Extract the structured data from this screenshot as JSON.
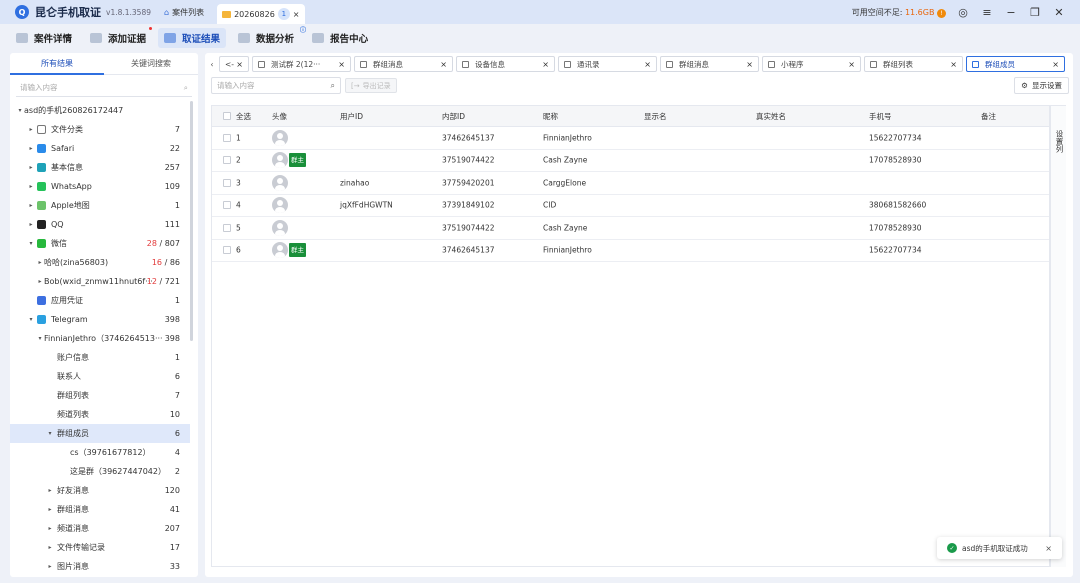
{
  "titlebar": {
    "app_name": "昆仑手机取证",
    "version": "v1.8.1.3589",
    "tabs": [
      {
        "label": "案件列表",
        "icon": "home-icon"
      },
      {
        "label": "20260826",
        "icon": "folder-icon",
        "badge": "1",
        "close": "×"
      }
    ],
    "storage_label": "可用空间不足:",
    "storage_value": "11.6GB",
    "storage_dot": "!"
  },
  "toolbar": {
    "items": [
      {
        "label": "案件详情"
      },
      {
        "label": "添加证据"
      },
      {
        "label": "取证结果"
      },
      {
        "label": "数据分析"
      },
      {
        "label": "报告中心"
      }
    ]
  },
  "left": {
    "tabs": [
      "所有结果",
      "关键词搜索"
    ],
    "search_placeholder": "请输入内容",
    "tree": [
      {
        "label": "asd的手机260826172447",
        "count": "",
        "arrow": "▾",
        "indent": 0,
        "icon": ""
      },
      {
        "label": "文件分类",
        "count": "7",
        "arrow": "▸",
        "indent": 1,
        "icon": "file-icon",
        "color": "#ffffff"
      },
      {
        "label": "Safari",
        "count": "22",
        "arrow": "▸",
        "indent": 1,
        "icon": "safari-icon",
        "color": "#2a8bea"
      },
      {
        "label": "基本信息",
        "count": "257",
        "arrow": "▸",
        "indent": 1,
        "icon": "info-icon",
        "color": "#1fa2b8"
      },
      {
        "label": "WhatsApp",
        "count": "109",
        "arrow": "▸",
        "indent": 1,
        "icon": "whatsapp-icon",
        "color": "#25c25a"
      },
      {
        "label": "Apple地图",
        "count": "1",
        "arrow": "▸",
        "indent": 1,
        "icon": "maps-icon",
        "color": "#6cc36a"
      },
      {
        "label": "QQ",
        "count": "111",
        "arrow": "▸",
        "indent": 1,
        "icon": "qq-icon",
        "color": "#222222"
      },
      {
        "label": "微信",
        "count_red": "28",
        "count_total": "807",
        "arrow": "▾",
        "indent": 1,
        "icon": "wechat-icon",
        "color": "#27b83d"
      },
      {
        "label": "哈哈(zina56803)",
        "count_red": "16",
        "count_total": "86",
        "arrow": "▸",
        "indent": 2,
        "icon": ""
      },
      {
        "label": "Bob(wxid_znmw11hnut6f···",
        "count_red": "12",
        "count_total": "721",
        "arrow": "▸",
        "indent": 2,
        "icon": ""
      },
      {
        "label": "应用凭证",
        "count": "1",
        "arrow": "",
        "indent": 1,
        "icon": "credential-icon",
        "color": "#3d6fe0"
      },
      {
        "label": "Telegram",
        "count": "398",
        "arrow": "▾",
        "indent": 1,
        "icon": "telegram-icon",
        "color": "#2aa0e0"
      },
      {
        "label": "FinnianJethro（3746264513···",
        "count": "398",
        "arrow": "▾",
        "indent": 2,
        "icon": ""
      },
      {
        "label": "账户信息",
        "count": "1",
        "arrow": "",
        "indent": 3,
        "icon": ""
      },
      {
        "label": "联系人",
        "count": "6",
        "arrow": "",
        "indent": 3,
        "icon": ""
      },
      {
        "label": "群组列表",
        "count": "7",
        "arrow": "",
        "indent": 3,
        "icon": ""
      },
      {
        "label": "频道列表",
        "count": "10",
        "arrow": "",
        "indent": 3,
        "icon": ""
      },
      {
        "label": "群组成员",
        "count": "6",
        "arrow": "▾",
        "indent": 3,
        "icon": "",
        "selected": true
      },
      {
        "label": "cs（39761677812）",
        "count": "4",
        "arrow": "",
        "indent": 4,
        "icon": ""
      },
      {
        "label": "这是群（39627447042）",
        "count": "2",
        "arrow": "",
        "indent": 4,
        "icon": ""
      },
      {
        "label": "好友消息",
        "count": "120",
        "arrow": "▸",
        "indent": 3,
        "icon": ""
      },
      {
        "label": "群组消息",
        "count": "41",
        "arrow": "▸",
        "indent": 3,
        "icon": ""
      },
      {
        "label": "频道消息",
        "count": "207",
        "arrow": "▸",
        "indent": 3,
        "icon": ""
      },
      {
        "label": "文件传输记录",
        "count": "17",
        "arrow": "▸",
        "indent": 3,
        "icon": ""
      },
      {
        "label": "图片消息",
        "count": "33",
        "arrow": "▸",
        "indent": 3,
        "icon": ""
      }
    ]
  },
  "main": {
    "tabs": [
      {
        "label": "<-",
        "close": "×",
        "w": 30
      },
      {
        "label": "测试群 2(12···",
        "close": "×",
        "w": 99
      },
      {
        "label": "群组消息",
        "close": "×",
        "w": 99
      },
      {
        "label": "设备信息",
        "close": "×",
        "w": 99
      },
      {
        "label": "通讯录",
        "close": "×",
        "w": 99
      },
      {
        "label": "群组消息",
        "close": "×",
        "w": 99
      },
      {
        "label": "小程序",
        "close": "×",
        "w": 99
      },
      {
        "label": "群组列表",
        "close": "×",
        "w": 99
      },
      {
        "label": "群组成员",
        "close": "×",
        "w": 99,
        "active": true
      }
    ],
    "search_placeholder": "请输入内容",
    "export_label": "导出记录",
    "display_settings": "显示设置",
    "side_panel": "设置列",
    "columns": [
      "全选",
      "头像",
      "用户ID",
      "内部ID",
      "昵称",
      "显示名",
      "真实姓名",
      "手机号",
      "备注"
    ],
    "rows": [
      {
        "idx": "1",
        "badge": "",
        "user_id": "",
        "internal_id": "37462645137",
        "nickname": "FinnianJethro",
        "display": "",
        "real_name": "",
        "phone": "15622707734",
        "note": ""
      },
      {
        "idx": "2",
        "badge": "群主",
        "user_id": "",
        "internal_id": "37519074422",
        "nickname": "Cash Zayne",
        "display": "",
        "real_name": "",
        "phone": "17078528930",
        "note": ""
      },
      {
        "idx": "3",
        "badge": "",
        "user_id": "zinahao",
        "internal_id": "37759420201",
        "nickname": "CarggElone",
        "display": "",
        "real_name": "",
        "phone": "",
        "note": ""
      },
      {
        "idx": "4",
        "badge": "",
        "user_id": "jqXfFdHGWTN",
        "internal_id": "37391849102",
        "nickname": "CID",
        "display": "",
        "real_name": "",
        "phone": "380681582660",
        "note": ""
      },
      {
        "idx": "5",
        "badge": "",
        "user_id": "",
        "internal_id": "37519074422",
        "nickname": "Cash Zayne",
        "display": "",
        "real_name": "",
        "phone": "17078528930",
        "note": ""
      },
      {
        "idx": "6",
        "badge": "群主",
        "user_id": "",
        "internal_id": "37462645137",
        "nickname": "FinnianJethro",
        "display": "",
        "real_name": "",
        "phone": "15622707734",
        "note": ""
      }
    ]
  },
  "toast": {
    "text": "asd的手机取证成功",
    "close": "×"
  }
}
